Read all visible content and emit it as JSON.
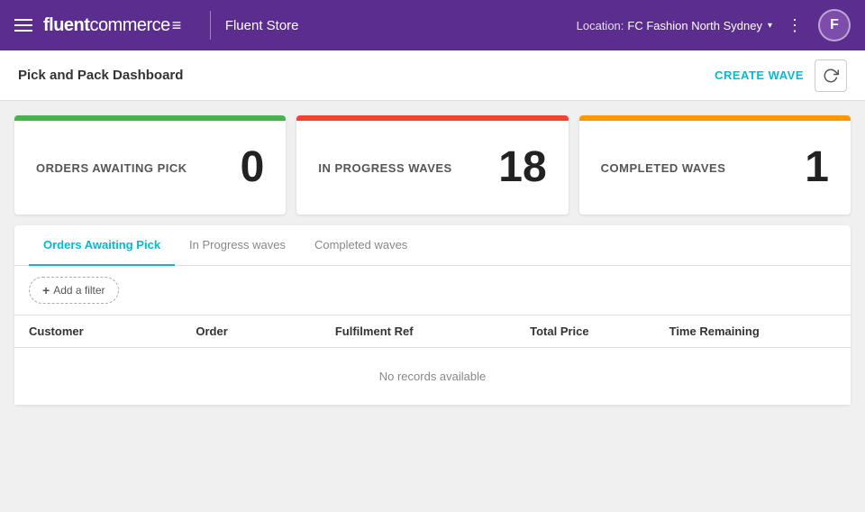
{
  "header": {
    "menu_icon_label": "menu",
    "logo_brand": "fluent",
    "logo_product": "commerce",
    "logo_symbol": "≡",
    "store_name": "Fluent Store",
    "location_label": "Location:",
    "location_value": "FC Fashion North Sydney",
    "more_icon": "⋮",
    "avatar_initial": "F"
  },
  "toolbar": {
    "title": "Pick and Pack Dashboard",
    "create_wave_label": "CREATE WAVE",
    "refresh_label": "Refresh"
  },
  "stat_cards": [
    {
      "label": "ORDERS AWAITING PICK",
      "value": "0",
      "bar_class": "bar-green"
    },
    {
      "label": "IN PROGRESS WAVES",
      "value": "18",
      "bar_class": "bar-red"
    },
    {
      "label": "COMPLETED WAVES",
      "value": "1",
      "bar_class": "bar-orange"
    }
  ],
  "tabs": [
    {
      "label": "Orders Awaiting Pick",
      "active": true
    },
    {
      "label": "In Progress waves",
      "active": false
    },
    {
      "label": "Completed waves",
      "active": false
    }
  ],
  "filter": {
    "add_label": "Add a filter"
  },
  "table": {
    "columns": [
      "Customer",
      "Order",
      "Fulfilment Ref",
      "Total Price",
      "Time Remaining"
    ],
    "empty_message": "No records available"
  }
}
